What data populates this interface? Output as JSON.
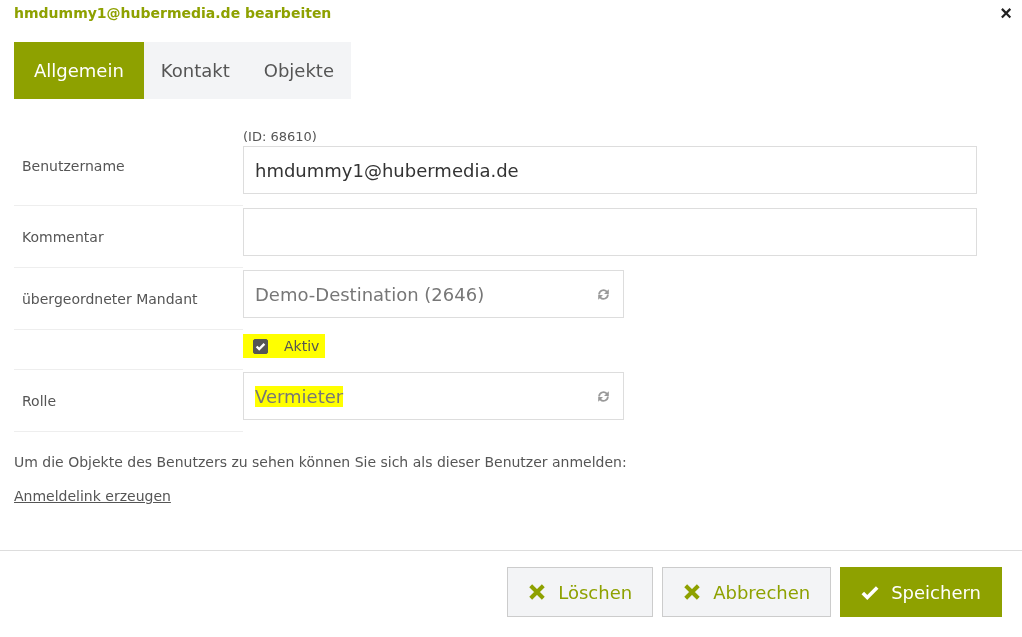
{
  "dialog": {
    "title": "hmdummy1@hubermedia.de bearbeiten",
    "close": "×"
  },
  "tabs": [
    {
      "label": "Allgemein",
      "selected": true
    },
    {
      "label": "Kontakt",
      "selected": false
    },
    {
      "label": "Objekte",
      "selected": false
    }
  ],
  "form": [
    {
      "kind": "text",
      "label": "Benutzername",
      "note": "(ID: 68610)",
      "value": "hmdummy1@hubermedia.de",
      "wide": true
    },
    {
      "kind": "text",
      "label": "Kommentar",
      "wide": true
    },
    {
      "kind": "select",
      "label": "übergeordneter Mandant",
      "value": "Demo-Destination (2646)",
      "wide": false
    },
    {
      "kind": "checkbox",
      "text": "Aktiv",
      "checked": true,
      "highlighted": true
    },
    {
      "kind": "select",
      "label": "Rolle",
      "value": "Vermieter",
      "wide": false,
      "highlighted": true
    }
  ],
  "info": "Um die Objekte des Benutzers zu sehen können Sie sich als dieser Benutzer anmelden:",
  "link": "Anmeldelink erzeugen",
  "buttons": [
    {
      "label": "Löschen",
      "kind": "secondary"
    },
    {
      "label": "Abbrechen",
      "kind": "secondary"
    },
    {
      "label": "Speichern",
      "kind": "primary"
    }
  ]
}
